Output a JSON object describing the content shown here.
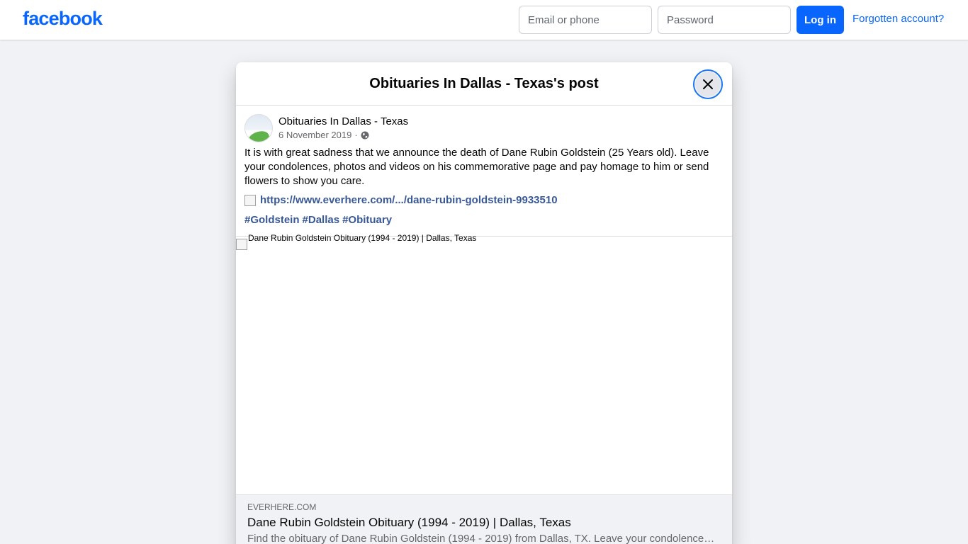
{
  "header": {
    "logo": "facebook",
    "email_placeholder": "Email or phone",
    "password_placeholder": "Password",
    "login_label": "Log in",
    "forgot_label": "Forgotten account?",
    "brand_color": "#0866ff"
  },
  "dialog": {
    "title": "Obituaries In Dallas - Texas's post",
    "close_icon": "close-icon"
  },
  "post": {
    "author": "Obituaries In Dallas - Texas",
    "date": "6 November 2019",
    "separator": "·",
    "privacy_icon": "globe-icon",
    "text": "It is with great sadness that we announce the death of Dane Rubin Goldstein (25 Years old). Leave your condolences, photos and videos on his commemorative page and pay homage to him or send flowers to show you care.",
    "link": "https://www.everhere.com/.../dane-rubin-goldstein-9933510",
    "hashtags": [
      "#Goldstein",
      "#Dallas",
      "#Obituary"
    ]
  },
  "attachment": {
    "image_alt": "Dane Rubin Goldstein Obituary (1994 - 2019) | Dallas, Texas",
    "domain": "EVERHERE.COM",
    "title": "Dane Rubin Goldstein Obituary (1994 - 2019) | Dallas, Texas",
    "description": "Find the obituary of Dane Rubin Goldstein (1994 - 2019) from Dallas, TX. Leave your condolences ..."
  }
}
